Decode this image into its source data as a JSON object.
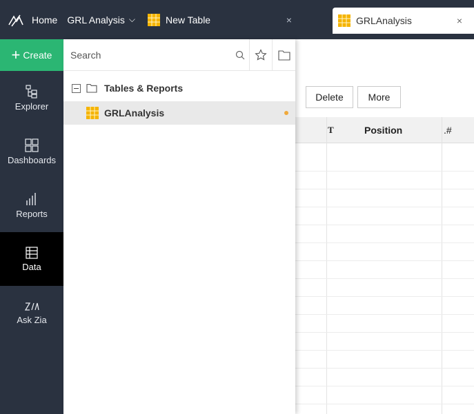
{
  "topbar": {
    "home": "Home",
    "workspace": "GRL Analysis",
    "tabs": [
      {
        "label": "New Table",
        "close": "×"
      },
      {
        "label": "GRLAnalysis",
        "close": "×"
      }
    ]
  },
  "rail": {
    "create": "Create",
    "items": [
      {
        "label": "Explorer",
        "icon": "explorer-icon"
      },
      {
        "label": "Dashboards",
        "icon": "dashboards-icon"
      },
      {
        "label": "Reports",
        "icon": "reports-icon"
      },
      {
        "label": "Data",
        "icon": "data-icon",
        "active": true
      },
      {
        "label": "Ask Zia",
        "icon": "zia-icon"
      }
    ]
  },
  "explorer": {
    "search_placeholder": "Search",
    "group": "Tables & Reports",
    "items": [
      {
        "label": "GRLAnalysis"
      }
    ]
  },
  "toolbar": {
    "delete": "Delete",
    "more": "More"
  },
  "table": {
    "columns": [
      {
        "type_icon": "T",
        "label": "Position"
      },
      {
        "type_icon": ".#",
        "label": ""
      }
    ]
  },
  "colors": {
    "topbar": "#2a3240",
    "create": "#2bb673",
    "accent": "#f0a93b",
    "active_rail": "#000000"
  }
}
